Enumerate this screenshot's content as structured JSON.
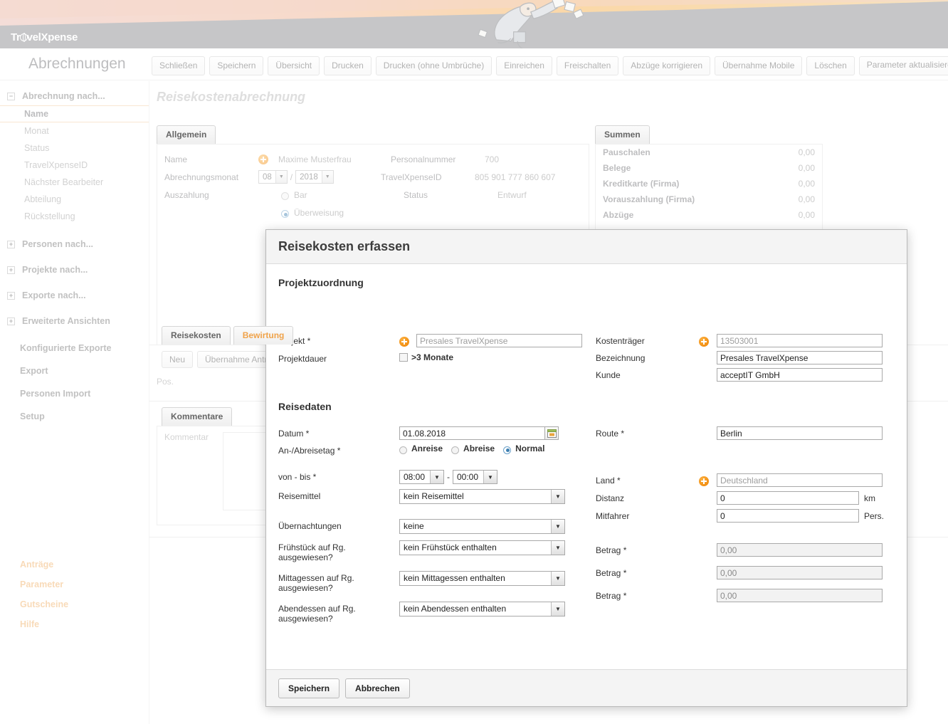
{
  "app": {
    "logo_text_1": "Tr",
    "logo_text_2": "vel",
    "logo_text_3": "Xpense",
    "title": "Abrechnungen"
  },
  "toolbar": {
    "buttons": [
      {
        "label": "Schließen"
      },
      {
        "label": "Speichern"
      },
      {
        "label": "Übersicht"
      },
      {
        "label": "Drucken"
      },
      {
        "label": "Drucken (ohne Umbrüche)"
      },
      {
        "label": "Einreichen"
      },
      {
        "label": "Freischalten"
      },
      {
        "label": "Abzüge korrigieren"
      },
      {
        "label": "Übernahme Mobile"
      },
      {
        "label": "Löschen"
      },
      {
        "label": "Parameter aktualisieren",
        "caret": "▾"
      }
    ]
  },
  "sidebar": {
    "groups": [
      {
        "label": "Abrechnung nach...",
        "toggle": "−",
        "items": [
          {
            "label": "Name",
            "active": true
          },
          {
            "label": "Monat",
            "active": false
          },
          {
            "label": "Status",
            "active": false
          },
          {
            "label": "TravelXpenseID",
            "active": false
          },
          {
            "label": "Nächster Bearbeiter",
            "active": false
          },
          {
            "label": "Abteilung",
            "active": false
          },
          {
            "label": "Rückstellung",
            "active": false
          }
        ]
      },
      {
        "label": "Personen nach...",
        "toggle": "+",
        "items": []
      },
      {
        "label": "Projekte nach...",
        "toggle": "+",
        "items": []
      },
      {
        "label": "Exporte nach...",
        "toggle": "+",
        "items": []
      },
      {
        "label": "Erweiterte Ansichten",
        "toggle": "+",
        "items": []
      }
    ],
    "links": [
      {
        "label": "Konfigurierte Exporte"
      },
      {
        "label": "Export"
      },
      {
        "label": "Personen Import"
      },
      {
        "label": "Setup"
      }
    ],
    "bottom_links": [
      {
        "label": "Anträge"
      },
      {
        "label": "Parameter"
      },
      {
        "label": "Gutscheine"
      },
      {
        "label": "Hilfe"
      }
    ],
    "accent_color": "#f0ad63"
  },
  "main": {
    "title": "Reisekostenabrechnung",
    "allgemein": {
      "tab": "Allgemein",
      "left": {
        "name_label": "Name",
        "name_value": "Maxime Musterfrau",
        "monat_label": "Abrechnungsmonat",
        "monat_value": "08",
        "jahr_value": "2018",
        "separator": "/",
        "auszahlung_label": "Auszahlung",
        "options": [
          {
            "label": "Bar",
            "selected": false
          },
          {
            "label": "Überweisung",
            "selected": true
          }
        ]
      },
      "right": [
        {
          "label": "Personalnummer",
          "value": "700"
        },
        {
          "label": "TravelXpenseID",
          "value": "805 901 777 860 607"
        },
        {
          "label": "Status",
          "value": "Entwurf"
        }
      ]
    },
    "summen": {
      "tab": "Summen",
      "rows": [
        {
          "label": "Pauschalen",
          "value": "0,00"
        },
        {
          "label": "Belege",
          "value": "0,00"
        },
        {
          "label": "Kreditkarte (Firma)",
          "value": "0,00"
        },
        {
          "label": "Vorauszahlung (Firma)",
          "value": "0,00"
        },
        {
          "label": "Abzüge",
          "value": "0,00"
        }
      ]
    },
    "detail_tabs": [
      {
        "label": "Reisekosten",
        "active": true
      },
      {
        "label": "Bewirtung",
        "active": false
      }
    ],
    "detail_buttons": [
      {
        "label": "Neu"
      },
      {
        "label": "Übernahme Antrag"
      }
    ],
    "detail_column": "Pos.",
    "kommentare": {
      "tab": "Kommentare",
      "label": "Kommentar"
    }
  },
  "modal": {
    "title": "Reisekosten erfassen",
    "section_projekt": "Projektzuordnung",
    "section_reise": "Reisedaten",
    "projekt": {
      "projekt_label": "Projekt *",
      "projekt_value": "Presales TravelXpense",
      "projektdauer_label": "Projektdauer",
      "monate_label": ">3 Monate",
      "monate_checked": false,
      "kostentraeger_label": "Kostenträger",
      "kostentraeger_value": "13503001",
      "bezeichnung_label": "Bezeichnung",
      "bezeichnung_value": "Presales TravelXpense",
      "kunde_label": "Kunde",
      "kunde_value": "acceptIT GmbH"
    },
    "reise": {
      "datum_label": "Datum *",
      "datum_value": "01.08.2018",
      "anabreise_label": "An-/Abreisetag *",
      "anabreise_options": [
        {
          "label": "Anreise",
          "selected": false
        },
        {
          "label": "Abreise",
          "selected": false
        },
        {
          "label": "Normal",
          "selected": true
        }
      ],
      "vonbis_label": "von - bis *",
      "von_value": "08:00",
      "bis_value": "00:00",
      "vonbis_separator": "-",
      "reisemittel_label": "Reisemittel",
      "reisemittel_value": "kein Reisemittel",
      "uebernachtungen_label": "Übernachtungen",
      "uebernachtungen_value": "keine",
      "fruehstueck_label": "Frühstück auf Rg. ausgewiesen?",
      "fruehstueck_value": "kein Frühstück enthalten",
      "mittagessen_label": "Mittagessen auf Rg. ausgewiesen?",
      "mittagessen_value": "kein Mittagessen enthalten",
      "abendessen_label": "Abendessen auf Rg. ausgewiesen?",
      "abendessen_value": "kein Abendessen enthalten",
      "route_label": "Route *",
      "route_value": "Berlin",
      "land_label": "Land *",
      "land_value": "Deutschland",
      "distanz_label": "Distanz",
      "distanz_value": "0",
      "distanz_unit": "km",
      "mitfahrer_label": "Mitfahrer",
      "mitfahrer_value": "0",
      "mitfahrer_unit": "Pers.",
      "betrag1_label": "Betrag *",
      "betrag1_value": "0,00",
      "betrag2_label": "Betrag *",
      "betrag2_value": "0,00",
      "betrag3_label": "Betrag *",
      "betrag3_value": "0,00"
    },
    "footer": {
      "save_label": "Speichern",
      "cancel_label": "Abbrechen"
    }
  },
  "icons": {
    "plus": "plus-circle-icon",
    "calendar": "calendar-icon",
    "chevron_down": "▾"
  }
}
